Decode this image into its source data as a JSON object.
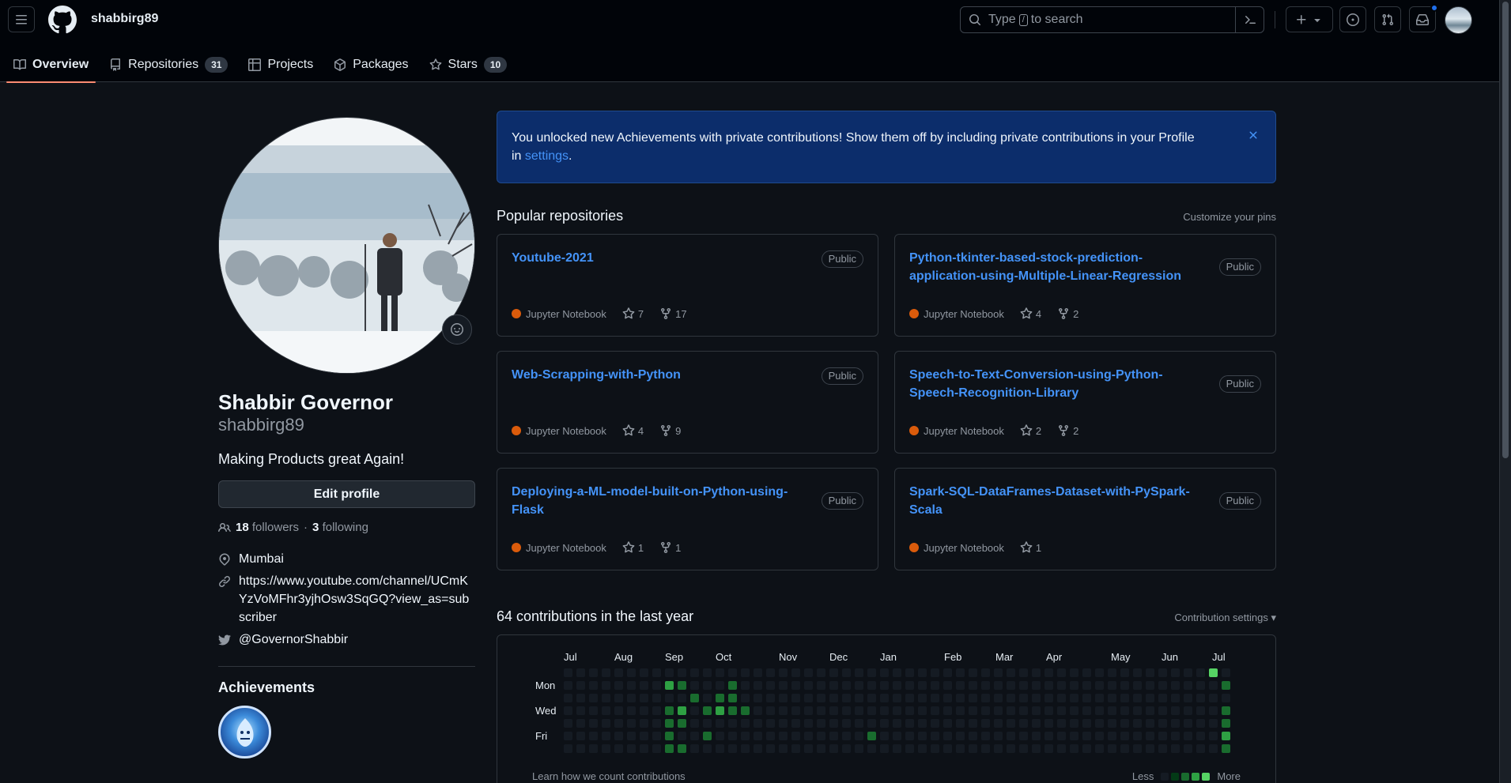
{
  "header": {
    "owner": "shabbirg89",
    "search_prefix": "Type",
    "search_key": "/",
    "search_suffix": "to search"
  },
  "tabs": [
    {
      "label": "Overview",
      "count": null
    },
    {
      "label": "Repositories",
      "count": "31"
    },
    {
      "label": "Projects",
      "count": null
    },
    {
      "label": "Packages",
      "count": null
    },
    {
      "label": "Stars",
      "count": "10"
    }
  ],
  "profile": {
    "name": "Shabbir Governor",
    "login": "shabbirg89",
    "bio": "Making Products great Again!",
    "edit_label": "Edit profile",
    "followers_count": "18",
    "followers_label": "followers",
    "dot": "·",
    "following_count": "3",
    "following_label": "following",
    "location": "Mumbai",
    "website": "https://www.youtube.com/channel/UCmKYzVoMFhr3yjhOsw3SqGQ?view_as=subscriber",
    "twitter": "@GovernorShabbir",
    "achievements_title": "Achievements"
  },
  "flash": {
    "text": "You unlocked new Achievements with private contributions! Show them off by including private contributions in your Profile in",
    "link": "settings",
    "end": "."
  },
  "pinned": {
    "title": "Popular repositories",
    "customize": "Customize your pins",
    "repos": [
      {
        "name": "Youtube-2021",
        "visibility": "Public",
        "language": "Jupyter Notebook",
        "stars": "7",
        "forks": "17"
      },
      {
        "name": "Python-tkinter-based-stock-prediction-application-using-Multiple-Linear-Regression",
        "visibility": "Public",
        "language": "Jupyter Notebook",
        "stars": "4",
        "forks": "2"
      },
      {
        "name": "Web-Scrapping-with-Python",
        "visibility": "Public",
        "language": "Jupyter Notebook",
        "stars": "4",
        "forks": "9"
      },
      {
        "name": "Speech-to-Text-Conversion-using-Python-Speech-Recognition-Library",
        "visibility": "Public",
        "language": "Jupyter Notebook",
        "stars": "2",
        "forks": "2"
      },
      {
        "name": "Deploying-a-ML-model-built-on-Python-using-Flask",
        "visibility": "Public",
        "language": "Jupyter Notebook",
        "stars": "1",
        "forks": "1"
      },
      {
        "name": "Spark-SQL-DataFrames-Dataset-with-PySpark-Scala",
        "visibility": "Public",
        "language": "Jupyter Notebook",
        "stars": "1",
        "forks": null
      }
    ]
  },
  "contributions": {
    "title": "64 contributions in the last year",
    "settings": "Contribution settings",
    "months": [
      "Jul",
      "Aug",
      "Sep",
      "Oct",
      "Nov",
      "Dec",
      "Jan",
      "Feb",
      "Mar",
      "Apr",
      "May",
      "Jun",
      "Jul"
    ],
    "days": [
      "Mon",
      "Wed",
      "Fri"
    ],
    "learn": "Learn how we count contributions",
    "less": "Less",
    "more": "More",
    "colors": [
      "#151b23",
      "#033a16",
      "#196c2e",
      "#2ea043",
      "#56d364"
    ],
    "week_count": 53,
    "cells": [
      [
        8,
        1,
        3
      ],
      [
        8,
        3,
        2
      ],
      [
        8,
        4,
        2
      ],
      [
        8,
        6,
        2
      ],
      [
        8,
        5,
        2
      ],
      [
        9,
        1,
        2
      ],
      [
        9,
        3,
        3
      ],
      [
        9,
        4,
        2
      ],
      [
        9,
        6,
        2
      ],
      [
        10,
        2,
        2
      ],
      [
        11,
        3,
        2
      ],
      [
        11,
        5,
        2
      ],
      [
        12,
        2,
        2
      ],
      [
        12,
        3,
        3
      ],
      [
        13,
        1,
        2
      ],
      [
        13,
        2,
        2
      ],
      [
        13,
        3,
        2
      ],
      [
        14,
        3,
        2
      ],
      [
        24,
        5,
        2
      ],
      [
        51,
        0,
        4
      ],
      [
        52,
        1,
        2
      ],
      [
        52,
        3,
        2
      ],
      [
        52,
        4,
        2
      ],
      [
        52,
        5,
        3
      ],
      [
        52,
        6,
        2
      ]
    ]
  }
}
